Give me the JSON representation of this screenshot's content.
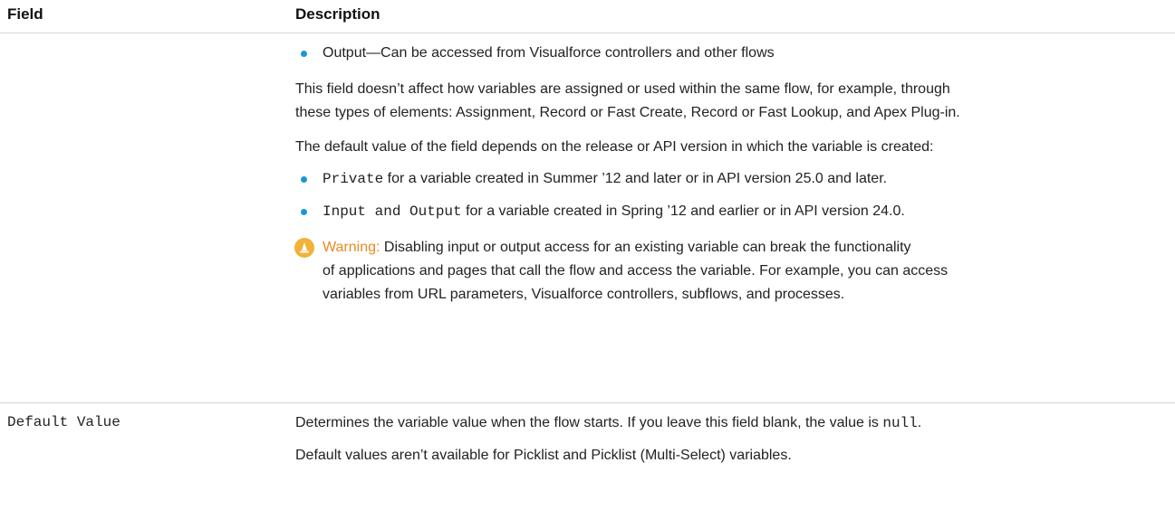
{
  "header": {
    "field": "Field",
    "description": "Description"
  },
  "row1": {
    "field": "",
    "bullet_output": "Output—Can be accessed from Visualforce controllers and other flows",
    "para1_line1": "This field doesn’t affect how variables are assigned or used within the same flow, for example, through",
    "para1_line2": "these types of elements: Assignment, Record or Fast Create, Record or Fast Lookup, and Apex Plug-in.",
    "para2": "The default value of the field depends on the release or API version in which the variable is created:",
    "bullet_private_code": "Private",
    "bullet_private_text": " for a variable created in Summer ’12 and later or in API version 25.0 and later.",
    "bullet_io_code": "Input and Output",
    "bullet_io_text": " for a variable created in Spring ’12 and earlier or in API version 24.0.",
    "warning": {
      "label": "Warning:",
      "line1": " Disabling input or output access for an existing variable can break the functionality",
      "line2": "of applications and pages that call the flow and access the variable. For example, you can access",
      "line3": "variables from URL parameters, Visualforce controllers, subflows, and processes."
    }
  },
  "row2": {
    "field": "Default Value",
    "line1_text": "Determines the variable value when the flow starts. If you leave this field blank, the value is ",
    "line1_code": "null",
    "line1_end": ".",
    "line2": "Default values aren’t available for Picklist and Picklist (Multi-Select) variables."
  },
  "colors": {
    "bullet": "#1b96d8",
    "warning_icon": "#f2b23a",
    "warning_label": "#e98a22"
  },
  "icons": {
    "warning": "warning-cone-icon"
  }
}
